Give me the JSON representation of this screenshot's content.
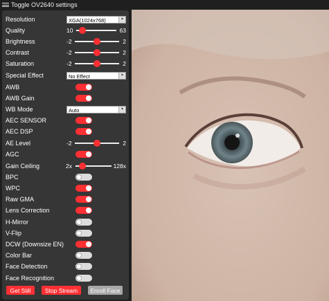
{
  "title": "Toggle OV2640 settings",
  "controls": {
    "resolution": {
      "label": "Resolution",
      "value": "XGA(1024x768)"
    },
    "quality": {
      "label": "Quality",
      "min": "10",
      "max": "63",
      "value": 0.15
    },
    "brightness": {
      "label": "Brightness",
      "min": "-2",
      "max": "2",
      "value": 0.5
    },
    "contrast": {
      "label": "Contrast",
      "min": "-2",
      "max": "2",
      "value": 0.5
    },
    "saturation": {
      "label": "Saturation",
      "min": "-2",
      "max": "2",
      "value": 0.5
    },
    "special_effect": {
      "label": "Special Effect",
      "value": "No Effect"
    },
    "awb": {
      "label": "AWB",
      "on": true
    },
    "awb_gain": {
      "label": "AWB Gain",
      "on": true
    },
    "wb_mode": {
      "label": "WB Mode",
      "value": "Auto"
    },
    "aec_sensor": {
      "label": "AEC SENSOR",
      "on": true
    },
    "aec_dsp": {
      "label": "AEC DSP",
      "on": true
    },
    "ae_level": {
      "label": "AE Level",
      "min": "-2",
      "max": "2",
      "value": 0.5
    },
    "agc": {
      "label": "AGC",
      "on": true
    },
    "gain_ceiling": {
      "label": "Gain Ceiling",
      "min": "2x",
      "max": "128x",
      "value": 0.2
    },
    "bpc": {
      "label": "BPC",
      "on": false
    },
    "wpc": {
      "label": "WPC",
      "on": true
    },
    "raw_gma": {
      "label": "Raw GMA",
      "on": true
    },
    "lens_correction": {
      "label": "Lens Correction",
      "on": true
    },
    "h_mirror": {
      "label": "H-Mirror",
      "on": false
    },
    "v_flip": {
      "label": "V-Flip",
      "on": false
    },
    "dcw": {
      "label": "DCW (Downsize EN)",
      "on": true
    },
    "color_bar": {
      "label": "Color Bar",
      "on": false
    },
    "face_detection": {
      "label": "Face Detection",
      "on": false
    },
    "face_recognition": {
      "label": "Face Recognition",
      "on": false
    }
  },
  "buttons": {
    "get_still": "Get Still",
    "stop_stream": "Stop Stream",
    "enroll_face": "Enroll Face"
  },
  "colors": {
    "accent": "#ff3034",
    "panel": "#363636",
    "background": "#1f1f1f"
  }
}
